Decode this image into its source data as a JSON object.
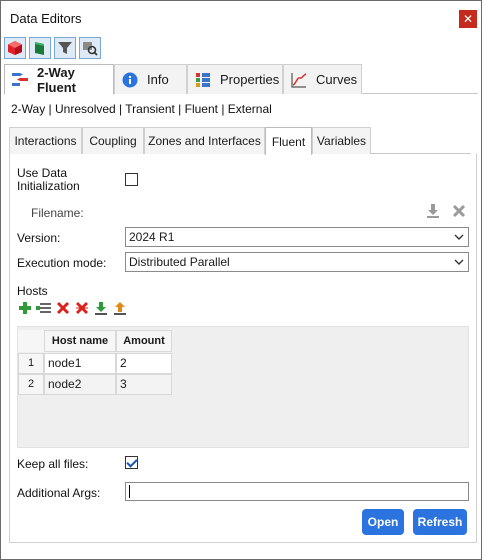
{
  "window": {
    "title": "Data Editors"
  },
  "main_tabs": [
    {
      "label": "2-Way Fluent",
      "icon": "coupling-icon"
    },
    {
      "label": "Info",
      "icon": "info-icon"
    },
    {
      "label": "Properties",
      "icon": "properties-icon"
    },
    {
      "label": "Curves",
      "icon": "curves-icon"
    }
  ],
  "breadcrumb": "2-Way | Unresolved | Transient | Fluent | External",
  "sub_tabs": [
    {
      "label": "Interactions"
    },
    {
      "label": "Coupling"
    },
    {
      "label": "Zones and Interfaces"
    },
    {
      "label": "Fluent"
    },
    {
      "label": "Variables"
    }
  ],
  "fluent": {
    "use_data_init_label_1": "Use Data",
    "use_data_init_label_2": "Initialization",
    "use_data_init_checked": false,
    "filename_label": "Filename:",
    "version_label": "Version:",
    "version_value": "2024 R1",
    "execution_label": "Execution mode:",
    "execution_value": "Distributed Parallel",
    "hosts_label": "Hosts",
    "hosts_columns": [
      "Host name",
      "Amount"
    ],
    "hosts_rows": [
      {
        "num": "1",
        "host": "node1",
        "amount": "2"
      },
      {
        "num": "2",
        "host": "node2",
        "amount": "3"
      }
    ],
    "keep_files_label": "Keep all files:",
    "keep_files_checked": true,
    "additional_args_label": "Additional Args:",
    "additional_args_value": ""
  },
  "buttons": {
    "open": "Open",
    "refresh": "Refresh"
  },
  "colors": {
    "accent": "#2b74e0",
    "close": "#c42b1c"
  }
}
